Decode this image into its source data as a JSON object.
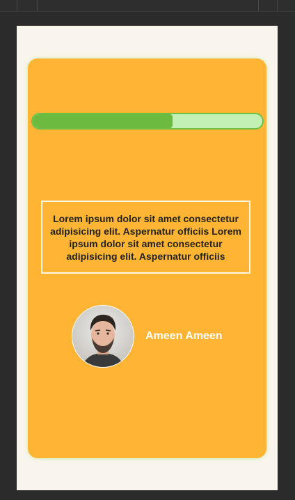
{
  "progress": {
    "value": 0.61,
    "fill_color": "#6cba40",
    "track_color": "#c3f0b3"
  },
  "card": {
    "background_color": "#ffb533",
    "quote": "Lorem ipsum dolor sit amet consectetur adipisicing elit. Aspernatur officiis Lorem ipsum dolor sit amet consectetur adipisicing elit. Aspernatur officiis",
    "author": {
      "name": "Ameen Ameen",
      "avatar_icon": "avatar-photo"
    }
  },
  "colors": {
    "page_background": "#faf5ec",
    "frame_background": "#2b2b2b",
    "text_light": "#ffffff",
    "text_dark": "#222222"
  }
}
